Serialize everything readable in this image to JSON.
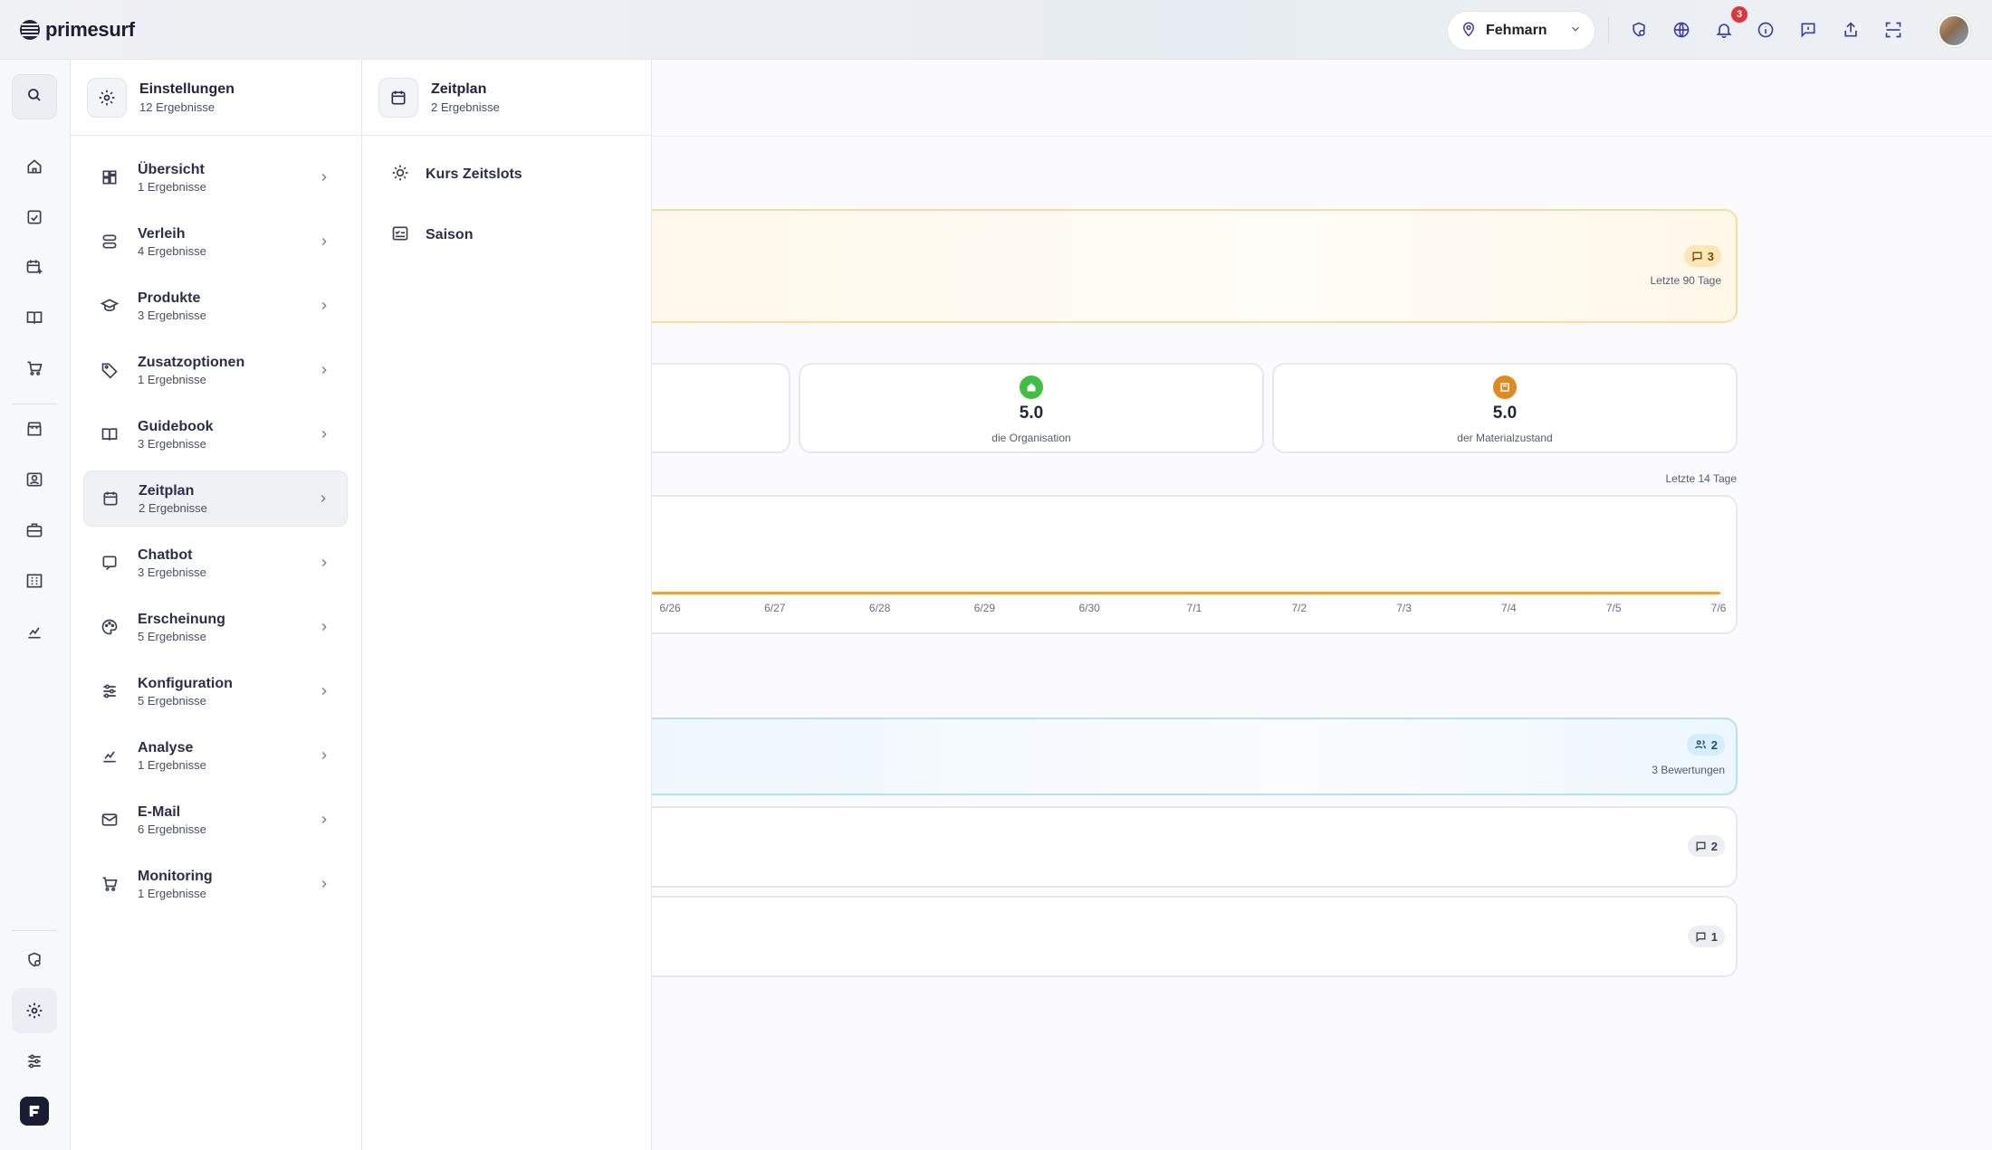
{
  "app": {
    "name": "primesurf"
  },
  "topbar": {
    "location": "Fehmarn",
    "notification_count": "3",
    "icons": [
      "shield-clock-icon",
      "globe-icon",
      "bell-icon",
      "info-icon",
      "message-icon",
      "share-icon",
      "qr-scan-icon"
    ]
  },
  "rail": {
    "icons": [
      "search-icon",
      "home-icon",
      "clipboard-check-icon",
      "calendar-plus-icon",
      "book-open-icon",
      "cart-icon",
      "store-icon",
      "id-card-icon",
      "briefcase-icon",
      "building-icon",
      "analytics-icon"
    ],
    "bottom_icons": [
      "shield-clock-icon",
      "gear-icon",
      "sliders-icon",
      "app-logo-icon"
    ]
  },
  "settings_panel": {
    "title": "Einstellungen",
    "subtitle": "12 Ergebnisse",
    "categories": [
      {
        "title": "Übersicht",
        "sub": "1 Ergebnisse",
        "icon": "dashboard-icon"
      },
      {
        "title": "Verleih",
        "sub": "4 Ergebnisse",
        "icon": "stack-icon"
      },
      {
        "title": "Produkte",
        "sub": "3 Ergebnisse",
        "icon": "graduation-cap-icon"
      },
      {
        "title": "Zusatzoptionen",
        "sub": "1 Ergebnisse",
        "icon": "tag-icon"
      },
      {
        "title": "Guidebook",
        "sub": "3 Ergebnisse",
        "icon": "book-open-icon"
      },
      {
        "title": "Zeitplan",
        "sub": "2 Ergebnisse",
        "icon": "calendar-icon",
        "active": true
      },
      {
        "title": "Chatbot",
        "sub": "3 Ergebnisse",
        "icon": "chat-bot-icon"
      },
      {
        "title": "Erscheinung",
        "sub": "5 Ergebnisse",
        "icon": "palette-icon"
      },
      {
        "title": "Konfiguration",
        "sub": "5 Ergebnisse",
        "icon": "sliders-icon"
      },
      {
        "title": "Analyse",
        "sub": "1 Ergebnisse",
        "icon": "analytics-icon"
      },
      {
        "title": "E-Mail",
        "sub": "6 Ergebnisse",
        "icon": "mail-icon"
      },
      {
        "title": "Monitoring",
        "sub": "1 Ergebnisse",
        "icon": "cart-icon"
      }
    ]
  },
  "zeitplan_panel": {
    "title": "Zeitplan",
    "subtitle": "2 Ergebnisse",
    "results": [
      {
        "label": "Kurs Zeitslots",
        "icon": "sun-icon"
      },
      {
        "label": "Saison",
        "icon": "checklist-icon"
      }
    ]
  },
  "background": {
    "feedback_count": "3",
    "feedback_period": "Letzte 90 Tage",
    "stats": [
      {
        "value": "5.0",
        "label": "die Organisation",
        "color": "#3fbf3f"
      },
      {
        "value": "5.0",
        "label": "der Materialzustand",
        "color": "#e08a1e"
      }
    ],
    "chart_period": "Letzte 14 Tage",
    "reviews_users": "2",
    "reviews_count": "3 Bewertungen",
    "comment_counts": [
      "2",
      "1"
    ]
  },
  "chart_data": {
    "type": "line",
    "x": [
      "6/26",
      "6/27",
      "6/28",
      "6/29",
      "6/30",
      "7/1",
      "7/2",
      "7/3",
      "7/4",
      "7/5",
      "7/6"
    ],
    "series": [
      {
        "values": [
          0,
          0,
          0,
          0,
          0,
          0,
          0,
          0,
          0,
          0,
          0
        ],
        "color": "#e8a33a"
      }
    ],
    "title": "",
    "xlabel": "",
    "ylabel": ""
  }
}
